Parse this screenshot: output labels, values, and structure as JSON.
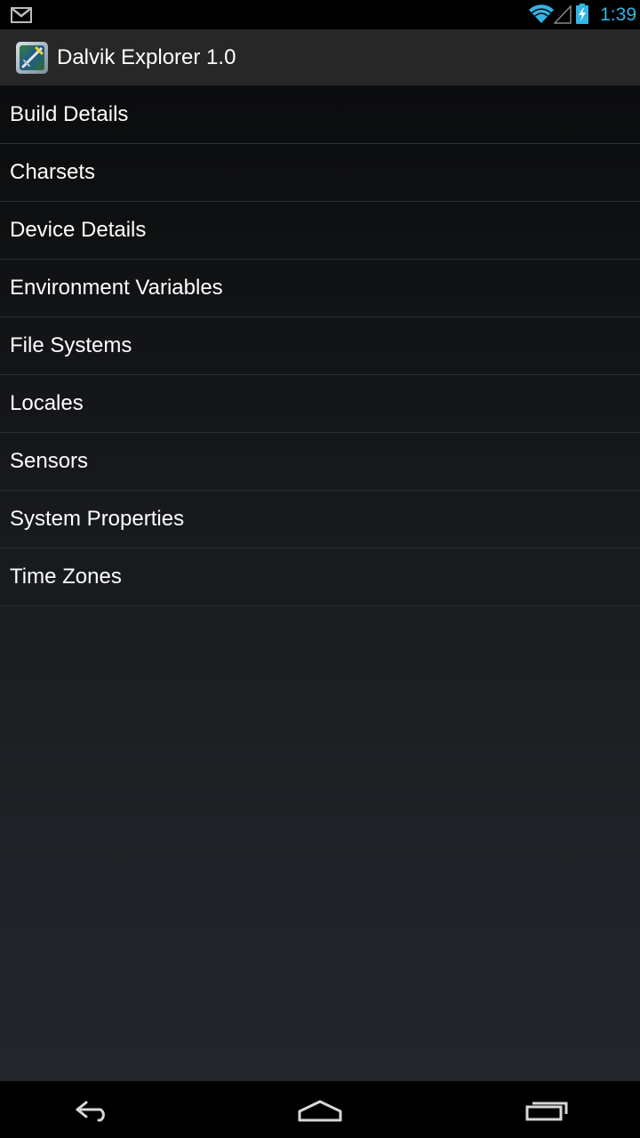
{
  "status_bar": {
    "time": "1:39",
    "icons": [
      "gmail-icon",
      "wifi-icon",
      "signal-icon",
      "battery-charging-icon"
    ],
    "accent_color": "#33b5e5"
  },
  "action_bar": {
    "app_icon": "dalvik-explorer-app-icon",
    "title": "Dalvik Explorer 1.0"
  },
  "menu": {
    "items": [
      {
        "label": "Build Details"
      },
      {
        "label": "Charsets"
      },
      {
        "label": "Device Details"
      },
      {
        "label": "Environment Variables"
      },
      {
        "label": "File Systems"
      },
      {
        "label": "Locales"
      },
      {
        "label": "Sensors"
      },
      {
        "label": "System Properties"
      },
      {
        "label": "Time Zones"
      }
    ]
  },
  "nav_bar": {
    "buttons": [
      "back-icon",
      "home-icon",
      "recent-apps-icon"
    ]
  }
}
